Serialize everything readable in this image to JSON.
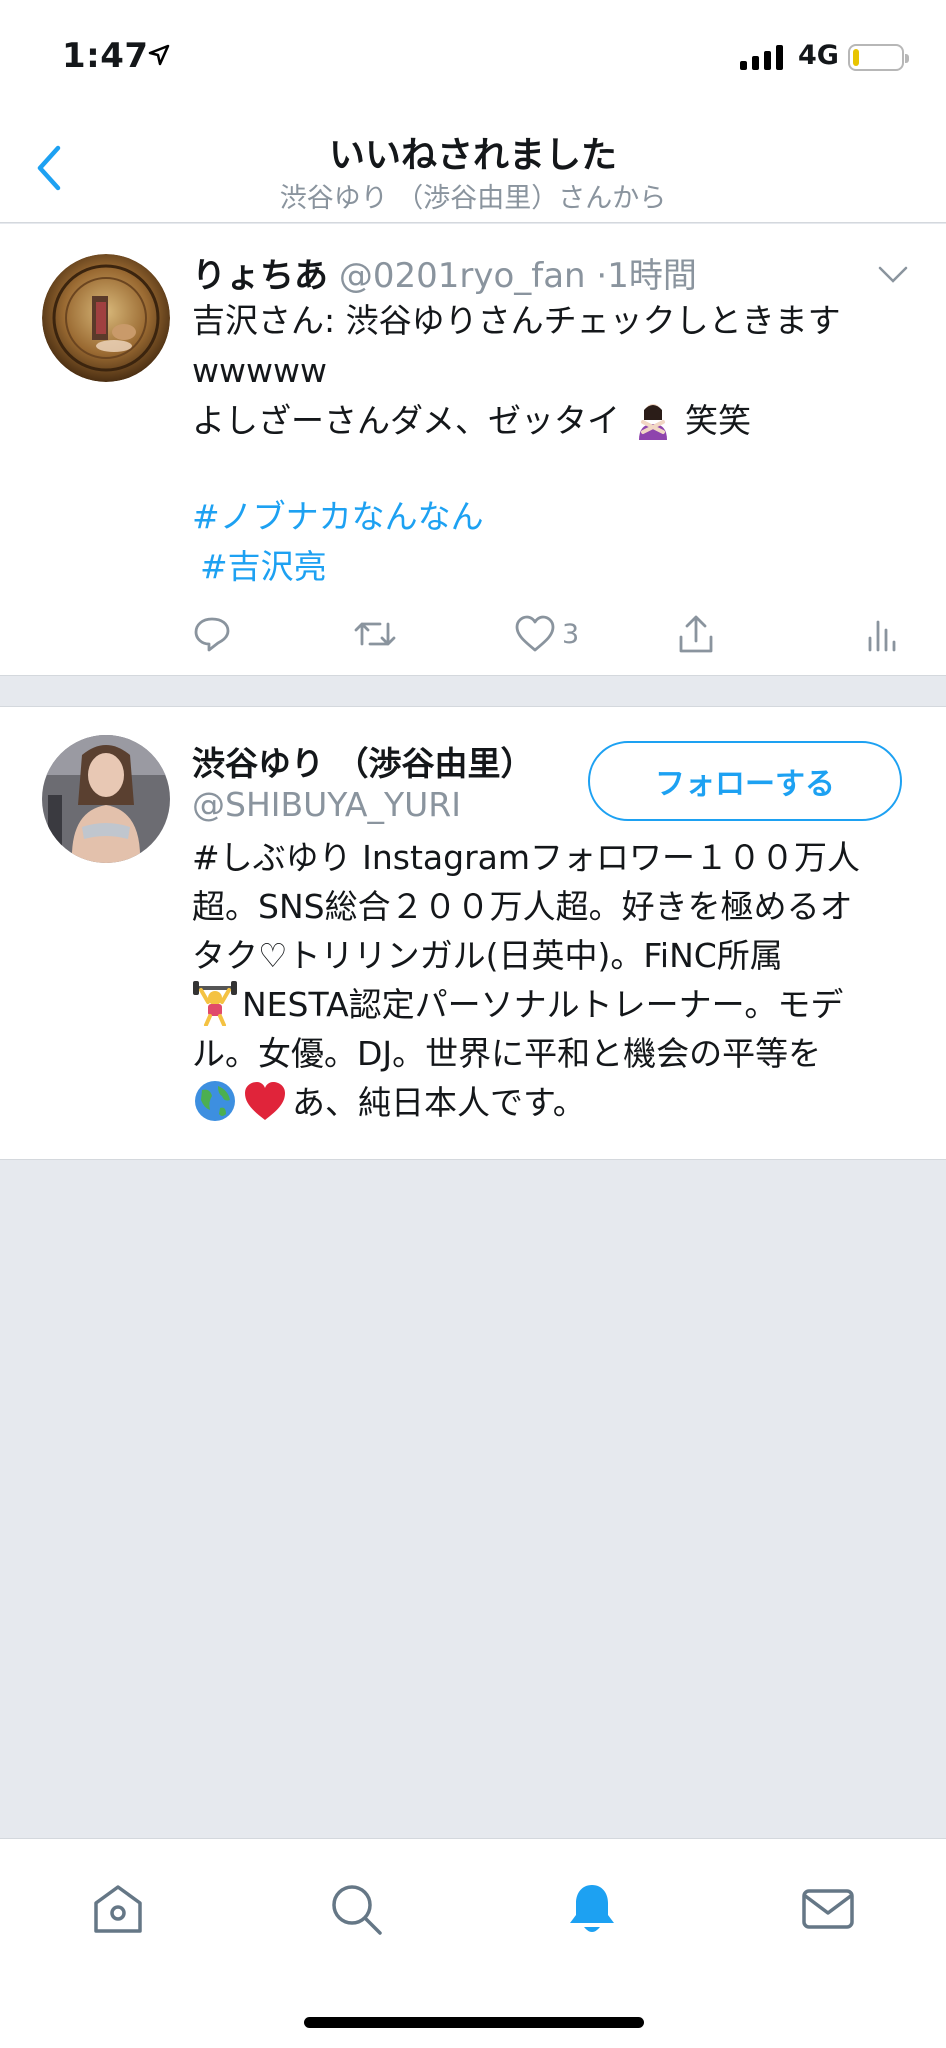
{
  "status_bar": {
    "time": "1:47",
    "network": "4G"
  },
  "nav": {
    "title": "いいねされました",
    "subtitle": "渋谷ゆり （渉谷由里）さんから"
  },
  "tweet": {
    "author_name": "りょちあ",
    "author_handle": "@0201ryo_fan",
    "time_separator": "·",
    "time": "1時間",
    "text_line_1": "吉沢さん: 渋谷ゆりさんチェックしときます",
    "text_line_2": "wwwww",
    "text_line_3a": "よしざーさんダメ、ゼッタイ",
    "text_line_3b": "笑笑",
    "hashtags": [
      "#ノブナカなんなん",
      "#吉沢亮"
    ],
    "like_count": "3"
  },
  "user": {
    "name": "渋谷ゆり （渉谷由里）",
    "handle": "@SHIBUYA_YURI",
    "follow_label": "フォローする",
    "bio_lines": [
      "#しぶゆり Instagramフォロワー１００万人",
      "超。SNS総合２００万人超。好きを極めるオ",
      "タク♡トリリンガル(日英中)。FiNC所属",
      "NESTA認定パーソナルトレーナー。モデ",
      "ル。女優。DJ。世界に平和と機会の平等を",
      "あ、純日本人です。"
    ]
  },
  "tabs": [
    "home-icon",
    "search-icon",
    "notifications-icon",
    "messages-icon"
  ],
  "colors": {
    "accent": "#1da1f2",
    "muted": "#8a949e",
    "background": "#e6e9ee"
  }
}
